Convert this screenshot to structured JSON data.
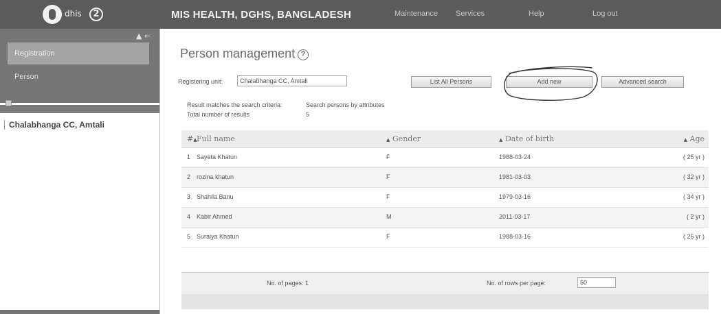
{
  "header": {
    "logo_text": "dhis",
    "logo_badge": "2",
    "title": "MIS HEALTH, DGHS, BANGLADESH",
    "menu": [
      "Maintenance",
      "Services",
      "Help",
      "Log out"
    ]
  },
  "sidebar": {
    "controls": "▲ ←",
    "items": [
      {
        "label": "Registration",
        "active": true
      },
      {
        "label": "Person",
        "active": false
      }
    ],
    "org_unit": "Chalabhanga CC, Amtali"
  },
  "page": {
    "title": "Person management",
    "help_icon": "?"
  },
  "search": {
    "registering_unit_label": "Registering unit:",
    "registering_unit_value": "Chalabhanga CC, Amtali",
    "list_all_button": "List All Persons",
    "add_new_button": "Add new",
    "advanced_search_button": "Advanced search"
  },
  "results": {
    "criteria_label": "Result matches the search criteria:",
    "criteria_value": "Search persons by attributes",
    "total_label": "Total number of results",
    "total_value": "5"
  },
  "table": {
    "columns": {
      "num": "#",
      "name": "Full name",
      "gender": "Gender",
      "dob": "Date of birth",
      "age": "Age"
    },
    "rows": [
      {
        "num": "1",
        "name": "Sayeta Khatun",
        "gender": "F",
        "dob": "1988-03-24",
        "age": "( 25 yr )"
      },
      {
        "num": "2",
        "name": "rozina khatun",
        "gender": "F",
        "dob": "1981-03-03",
        "age": "( 32 yr )"
      },
      {
        "num": "3",
        "name": "Shahila Banu",
        "gender": "F",
        "dob": "1979-03-16",
        "age": "( 34 yr )"
      },
      {
        "num": "4",
        "name": "Kabir Ahmed",
        "gender": "M",
        "dob": "2011-03-17",
        "age": "( 2 yr )"
      },
      {
        "num": "5",
        "name": "Suraiya Khatun",
        "gender": "F",
        "dob": "1988-03-16",
        "age": "( 25 yr )"
      }
    ]
  },
  "footer": {
    "pages_label": "No. of pages: 1",
    "rows_label": "No. of rows per page:",
    "rows_value": "50"
  },
  "colors": {
    "header_bg": "#5b5b5b",
    "sidebar_bg": "#767676",
    "active_item_bg": "#a4a4a4"
  }
}
